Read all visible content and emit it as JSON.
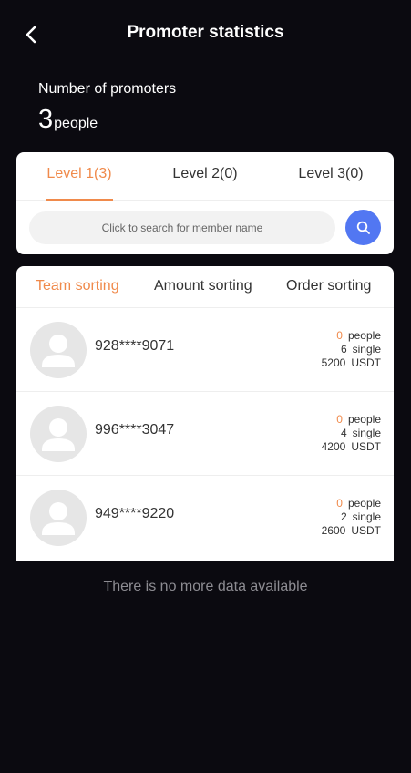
{
  "header": {
    "title": "Promoter statistics",
    "back_icon": "chevron-left-icon"
  },
  "summary": {
    "label": "Number of promoters",
    "count": "3",
    "unit": "people"
  },
  "levels": {
    "tabs": [
      {
        "label": "Level 1(3)",
        "active": true
      },
      {
        "label": "Level 2(0)",
        "active": false
      },
      {
        "label": "Level 3(0)",
        "active": false
      }
    ]
  },
  "search": {
    "placeholder": "Click to search for member name",
    "icon": "search-icon"
  },
  "sorting": {
    "tabs": [
      {
        "label": "Team sorting",
        "active": true
      },
      {
        "label": "Amount sorting",
        "active": false
      },
      {
        "label": "Order sorting",
        "active": false
      }
    ]
  },
  "members": [
    {
      "id": "928****9071",
      "people": "0",
      "people_unit": "people",
      "orders": "6",
      "orders_unit": "single",
      "amount": "5200",
      "currency": "USDT"
    },
    {
      "id": "996****3047",
      "people": "0",
      "people_unit": "people",
      "orders": "4",
      "orders_unit": "single",
      "amount": "4200",
      "currency": "USDT"
    },
    {
      "id": "949****9220",
      "people": "0",
      "people_unit": "people",
      "orders": "2",
      "orders_unit": "single",
      "amount": "2600",
      "currency": "USDT"
    }
  ],
  "footer": {
    "no_more": "There is no more data available"
  },
  "colors": {
    "background": "#0b0a10",
    "accent": "#f08a4b",
    "search_button": "#5277f2"
  }
}
